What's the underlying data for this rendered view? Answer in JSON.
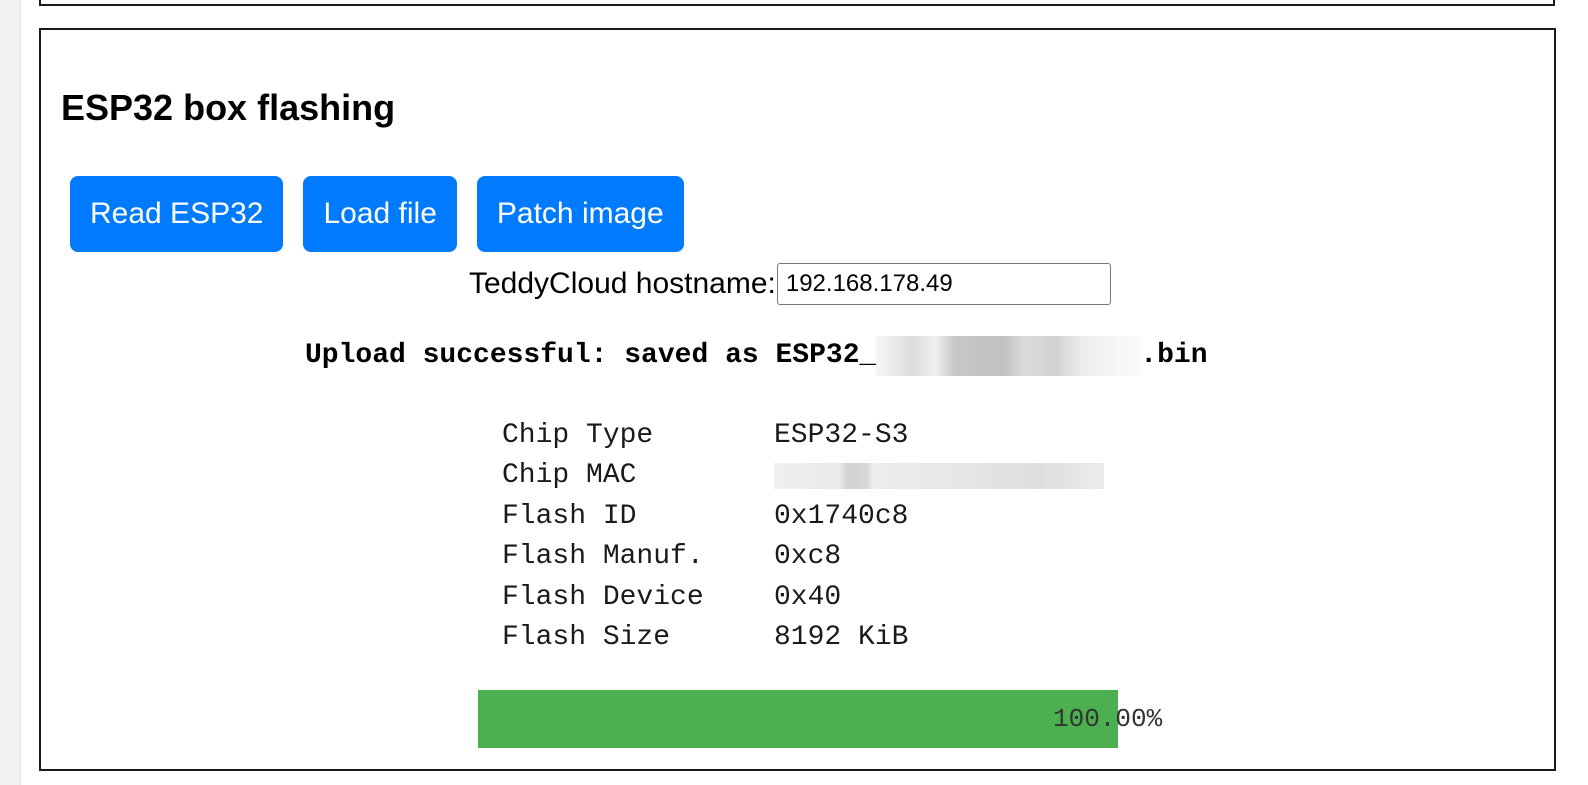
{
  "panel": {
    "title": "ESP32 box flashing"
  },
  "toolbar": {
    "read_label": "Read ESP32",
    "load_label": "Load file",
    "patch_label": "Patch image"
  },
  "hostname": {
    "label": "TeddyCloud hostname:",
    "value": "192.168.178.49"
  },
  "upload": {
    "prefix": "Upload successful: saved as ESP32_",
    "suffix": ".bin"
  },
  "chip_info": [
    {
      "key": "Chip Type",
      "value": "ESP32-S3"
    },
    {
      "key": "Chip MAC",
      "value": ""
    },
    {
      "key": "Flash ID",
      "value": "0x1740c8"
    },
    {
      "key": "Flash Manuf.",
      "value": "0xc8"
    },
    {
      "key": "Flash Device",
      "value": "0x40"
    },
    {
      "key": "Flash Size",
      "value": "8192 KiB"
    }
  ],
  "progress": {
    "fraction": 1.0,
    "label": "100.00%",
    "color": "#4caf50"
  },
  "colors": {
    "button": "#007bff",
    "border": "#1a1a1a"
  }
}
